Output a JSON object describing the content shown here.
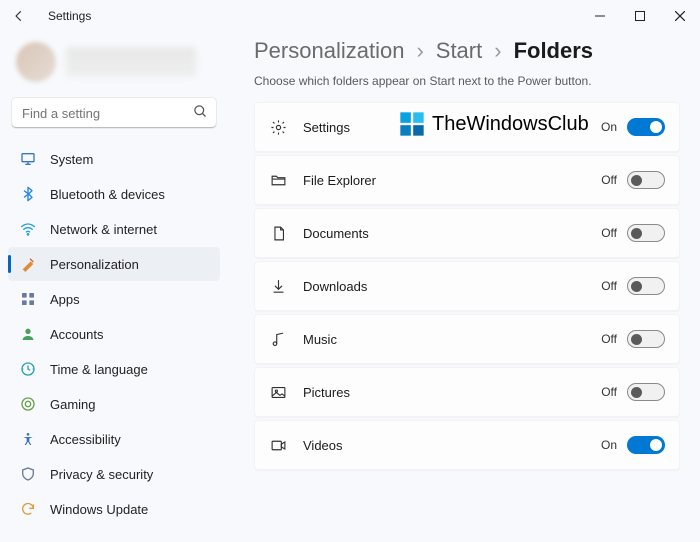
{
  "window": {
    "title": "Settings"
  },
  "search": {
    "placeholder": "Find a setting"
  },
  "sidebar": {
    "items": [
      {
        "label": "System"
      },
      {
        "label": "Bluetooth & devices"
      },
      {
        "label": "Network & internet"
      },
      {
        "label": "Personalization"
      },
      {
        "label": "Apps"
      },
      {
        "label": "Accounts"
      },
      {
        "label": "Time & language"
      },
      {
        "label": "Gaming"
      },
      {
        "label": "Accessibility"
      },
      {
        "label": "Privacy & security"
      },
      {
        "label": "Windows Update"
      }
    ]
  },
  "breadcrumb": {
    "a": "Personalization",
    "b": "Start",
    "c": "Folders"
  },
  "description": "Choose which folders appear on Start next to the Power button.",
  "rows": [
    {
      "label": "Settings",
      "state": "On"
    },
    {
      "label": "File Explorer",
      "state": "Off"
    },
    {
      "label": "Documents",
      "state": "Off"
    },
    {
      "label": "Downloads",
      "state": "Off"
    },
    {
      "label": "Music",
      "state": "Off"
    },
    {
      "label": "Pictures",
      "state": "Off"
    },
    {
      "label": "Videos",
      "state": "On"
    }
  ],
  "watermark": {
    "text": "TheWindowsClub"
  }
}
